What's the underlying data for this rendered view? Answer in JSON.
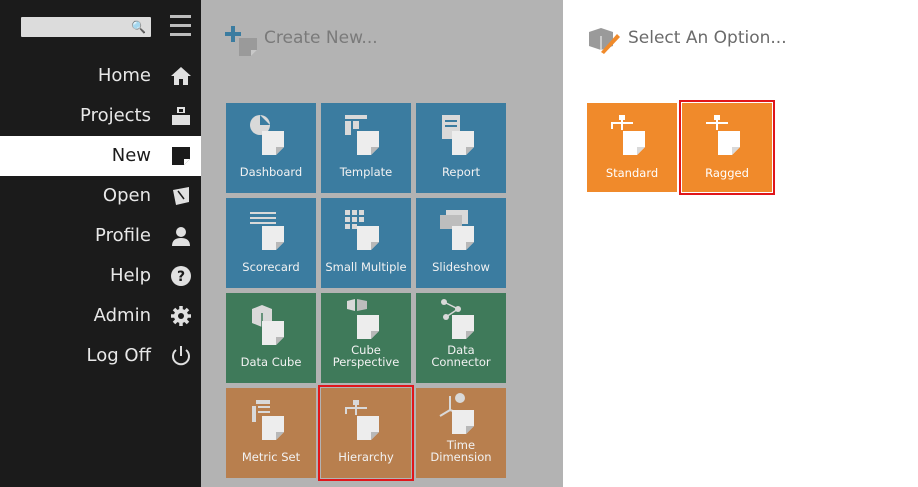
{
  "sidebar": {
    "search": {
      "placeholder": "",
      "icon": "search-icon"
    },
    "items": [
      {
        "label": "Home",
        "icon": "home-icon",
        "active": false
      },
      {
        "label": "Projects",
        "icon": "briefcase-icon",
        "active": false
      },
      {
        "label": "New",
        "icon": "new-document-icon",
        "active": true
      },
      {
        "label": "Open",
        "icon": "open-folder-icon",
        "active": false
      },
      {
        "label": "Profile",
        "icon": "user-icon",
        "active": false
      },
      {
        "label": "Help",
        "icon": "help-icon",
        "active": false
      },
      {
        "label": "Admin",
        "icon": "gear-icon",
        "active": false
      },
      {
        "label": "Log Off",
        "icon": "power-icon",
        "active": false
      }
    ]
  },
  "create": {
    "title": "Create New...",
    "tiles": [
      {
        "label": "Dashboard",
        "color": "#3b7ca0"
      },
      {
        "label": "Template",
        "color": "#3b7ca0"
      },
      {
        "label": "Report",
        "color": "#3b7ca0"
      },
      {
        "label": "Scorecard",
        "color": "#3b7ca0"
      },
      {
        "label": "Small Multiple",
        "color": "#3b7ca0"
      },
      {
        "label": "Slideshow",
        "color": "#3b7ca0"
      },
      {
        "label": "Data Cube",
        "color": "#3f7a5a"
      },
      {
        "label": "Cube\nPerspective",
        "color": "#3f7a5a"
      },
      {
        "label": "Data\nConnector",
        "color": "#3f7a5a"
      },
      {
        "label": "Metric Set",
        "color": "#b87f4e"
      },
      {
        "label": "Hierarchy",
        "color": "#b87f4e"
      },
      {
        "label": "Time\nDimension",
        "color": "#b87f4e"
      }
    ]
  },
  "select": {
    "title": "Select An Option...",
    "options": [
      {
        "label": "Standard",
        "color": "#f08a2b"
      },
      {
        "label": "Ragged",
        "color": "#f08a2b"
      }
    ]
  },
  "colors": {
    "sidebar_bg": "#1b1b1b",
    "middle_bg": "#b3b3b3",
    "highlight": "#e0161b"
  }
}
